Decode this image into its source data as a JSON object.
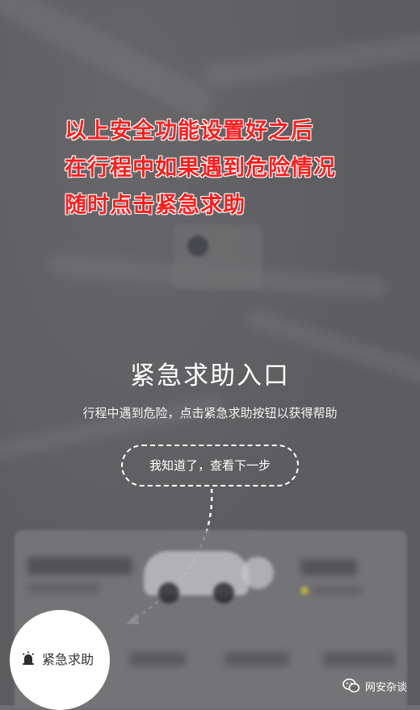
{
  "caption": {
    "lines": [
      "以上安全功能设置好之后",
      "在行程中如果遇到危险情况",
      "随时点击紧急求助"
    ],
    "color": "#ff1d1d"
  },
  "guide": {
    "title": "紧急求助入口",
    "description": "行程中遇到危险，点击紧急求助按钮以获得帮助",
    "next_button_label": "我知道了，查看下一步"
  },
  "sos": {
    "label": "紧急求助",
    "icon": "alarm-icon"
  },
  "watermark": {
    "text": "网安杂谈",
    "icon": "wechat-icon"
  }
}
